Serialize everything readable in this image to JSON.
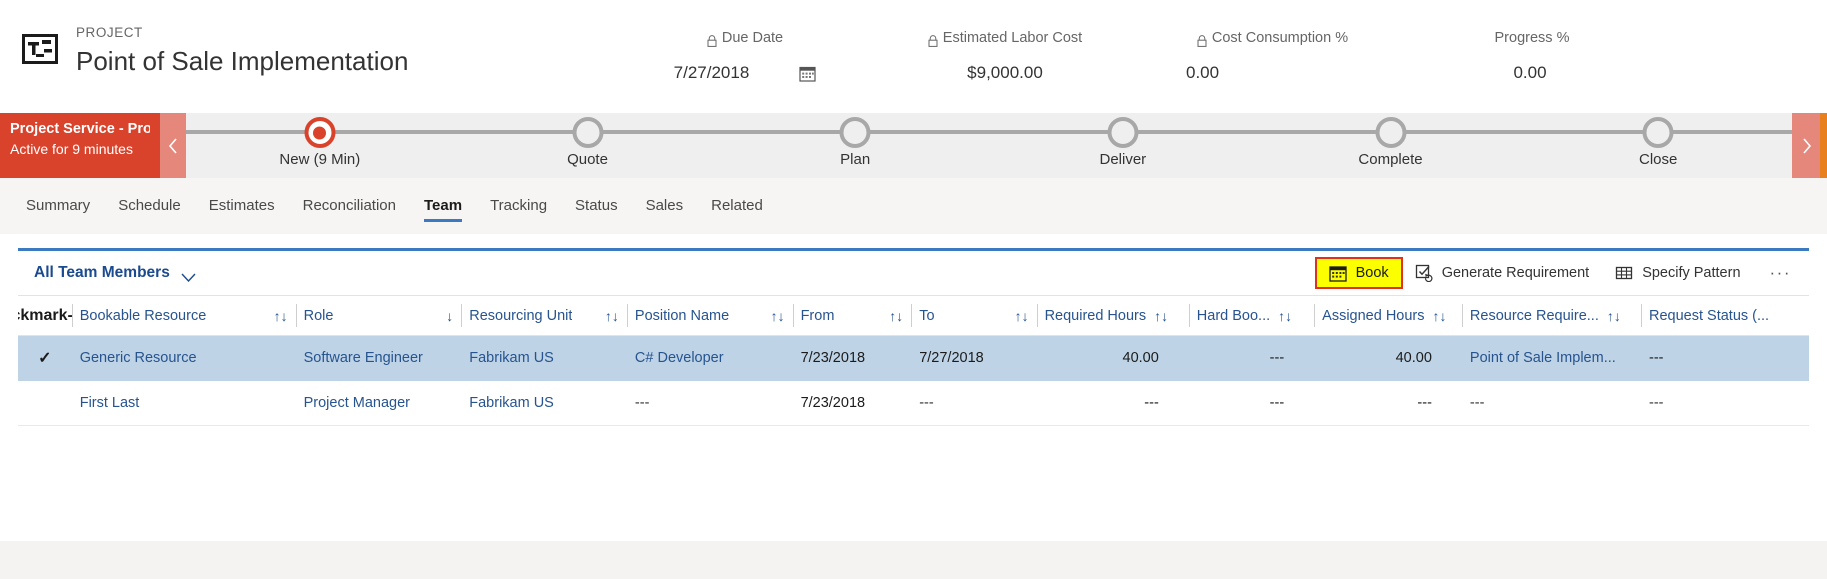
{
  "header": {
    "entity_type": "PROJECT",
    "record_title": "Point of Sale Implementation",
    "entity_icon": "project-icon",
    "metrics": [
      {
        "label": "Due Date",
        "value": "7/27/2018",
        "locked": true,
        "icon": "calendar-icon"
      },
      {
        "label": "Estimated Labor Cost",
        "value": "$9,000.00",
        "locked": true
      },
      {
        "label": "Cost Consumption %",
        "value": "0.00",
        "locked": true
      },
      {
        "label": "Progress %",
        "value": "0.00",
        "locked": false
      }
    ]
  },
  "process_flow": {
    "stage_title": "Project Service - Project ...",
    "stage_subtitle": "Active for 9 minutes",
    "prev_icon": "chevron-left-icon",
    "next_icon": "chevron-right-icon",
    "stages": [
      {
        "name": "New  (9 Min)",
        "active": true
      },
      {
        "name": "Quote",
        "active": false
      },
      {
        "name": "Plan",
        "active": false
      },
      {
        "name": "Deliver",
        "active": false
      },
      {
        "name": "Complete",
        "active": false
      },
      {
        "name": "Close",
        "active": false
      }
    ],
    "accent_color": "#d9432c",
    "rail_color": "#e8801f"
  },
  "tabs": [
    {
      "label": "Summary",
      "active": false
    },
    {
      "label": "Schedule",
      "active": false
    },
    {
      "label": "Estimates",
      "active": false
    },
    {
      "label": "Reconciliation",
      "active": false
    },
    {
      "label": "Team",
      "active": true
    },
    {
      "label": "Tracking",
      "active": false
    },
    {
      "label": "Status",
      "active": false
    },
    {
      "label": "Sales",
      "active": false
    },
    {
      "label": "Related",
      "active": false
    }
  ],
  "grid_toolbar": {
    "view_name": "All Team Members",
    "view_chevron": "chevron-down-icon",
    "actions": [
      {
        "label": "Book",
        "icon": "calendar-icon",
        "highlighted": true
      },
      {
        "label": "Generate Requirement",
        "icon": "checkbox-refresh-icon",
        "highlighted": false
      },
      {
        "label": "Specify Pattern",
        "icon": "grid-pattern-icon",
        "highlighted": false
      }
    ],
    "overflow": "···",
    "highlight_color": "#fbff00",
    "highlight_border": "#e03020"
  },
  "grid": {
    "select_all_icon": "checkmark-icon",
    "columns": [
      {
        "label": "Bookable Resource",
        "sort": "↑↓"
      },
      {
        "label": "Role",
        "sort": "↓"
      },
      {
        "label": "Resourcing Unit",
        "sort": "↑↓"
      },
      {
        "label": "Position Name",
        "sort": "↑↓"
      },
      {
        "label": "From",
        "sort": "↑↓"
      },
      {
        "label": "To",
        "sort": "↑↓"
      },
      {
        "label": "Required Hours",
        "sort": "↑↓"
      },
      {
        "label": "Hard Boo...",
        "sort": "↑↓"
      },
      {
        "label": "Assigned Hours",
        "sort": "↑↓"
      },
      {
        "label": "Resource Require...",
        "sort": "↑↓"
      },
      {
        "label": "Request Status (...",
        "sort": ""
      }
    ],
    "rows": [
      {
        "selected": true,
        "check": "✓",
        "bookable_resource": "Generic Resource",
        "role": "Software Engineer",
        "resourcing_unit": "Fabrikam US",
        "position_name": "C# Developer",
        "from": "7/23/2018",
        "to": "7/27/2018",
        "required_hours": "40.00",
        "hard_booked": "---",
        "assigned_hours": "40.00",
        "resource_requirement": "Point of Sale Implem...",
        "request_status": "---"
      },
      {
        "selected": false,
        "check": "",
        "bookable_resource": "First Last",
        "role": "Project Manager",
        "resourcing_unit": "Fabrikam US",
        "position_name": "---",
        "from": "7/23/2018",
        "to": "---",
        "required_hours": "---",
        "hard_booked": "---",
        "assigned_hours": "---",
        "resource_requirement": "---",
        "request_status": "---"
      }
    ]
  }
}
